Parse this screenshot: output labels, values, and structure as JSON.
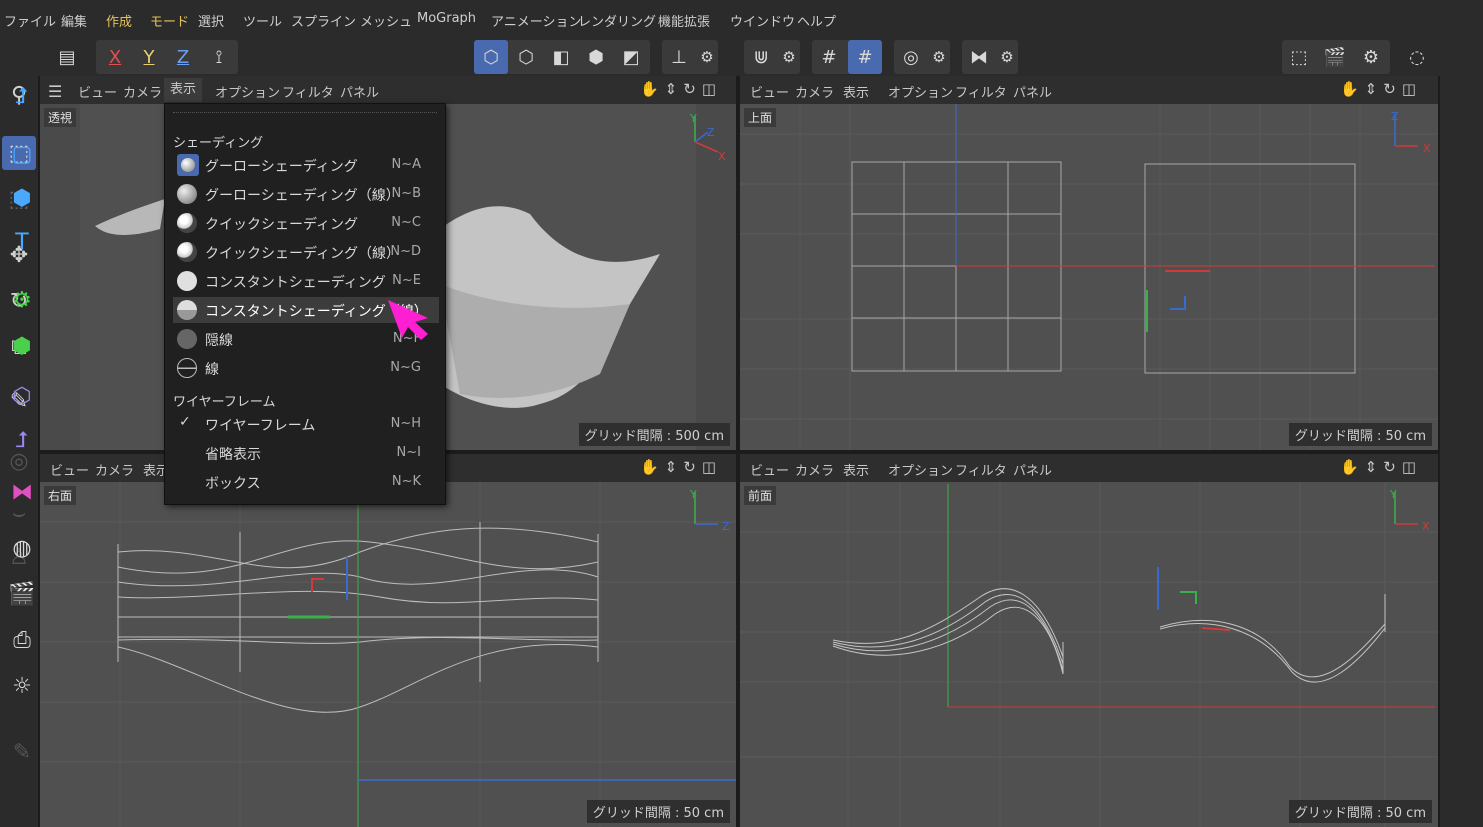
{
  "menubar": {
    "items": [
      "ファイル",
      "編集",
      "作成",
      "モード",
      "選択",
      "ツール",
      "スプライン",
      "メッシュ",
      "MoGraph",
      "アニメーション",
      "レンダリング",
      "機能拡張",
      "ウインドウ",
      "ヘルプ"
    ]
  },
  "toolbar": {
    "axis_x": "X",
    "axis_y": "Y",
    "axis_z": "Z"
  },
  "viewport_menu": {
    "items": [
      "ビュー",
      "カメラ",
      "表示",
      "オプション",
      "フィルタ",
      "パネル"
    ]
  },
  "viewports": {
    "perspective": {
      "label": "透視",
      "grid": "グリッド間隔 : 500 cm"
    },
    "top": {
      "label": "上面",
      "grid": "グリッド間隔 : 50 cm"
    },
    "right": {
      "label": "右面",
      "grid": "グリッド間隔 : 50 cm"
    },
    "front": {
      "label": "前面",
      "grid": "グリッド間隔 : 50 cm"
    }
  },
  "axis_labels": {
    "x": "X",
    "y": "Y",
    "z": "Z"
  },
  "dropdown": {
    "shading_header": "シェーディング",
    "wireframe_header": "ワイヤーフレーム",
    "shading_items": [
      {
        "label": "グーローシェーディング",
        "shortcut": "N~A"
      },
      {
        "label": "グーローシェーディング（線）",
        "shortcut": "N~B"
      },
      {
        "label": "クイックシェーディング",
        "shortcut": "N~C"
      },
      {
        "label": "クイックシェーディング（線）",
        "shortcut": "N~D"
      },
      {
        "label": "コンスタントシェーディング",
        "shortcut": "N~E"
      },
      {
        "label": "コンスタントシェーディング（線）",
        "shortcut": "N~F"
      },
      {
        "label": "隠線",
        "shortcut": "N~F"
      },
      {
        "label": "線",
        "shortcut": "N~G"
      }
    ],
    "wire_items": [
      {
        "label": "ワイヤーフレーム",
        "shortcut": "N~H"
      },
      {
        "label": "省略表示",
        "shortcut": "N~I"
      },
      {
        "label": "ボックス",
        "shortcut": "N~K"
      }
    ]
  },
  "colors": {
    "accent": "#4a6ab0",
    "highlight_menu": "#e6c15a",
    "cursor": "#ff1fd2",
    "x_axis": "#d03a3a",
    "y_axis": "#3ab04a",
    "z_axis": "#3a6ad0"
  }
}
